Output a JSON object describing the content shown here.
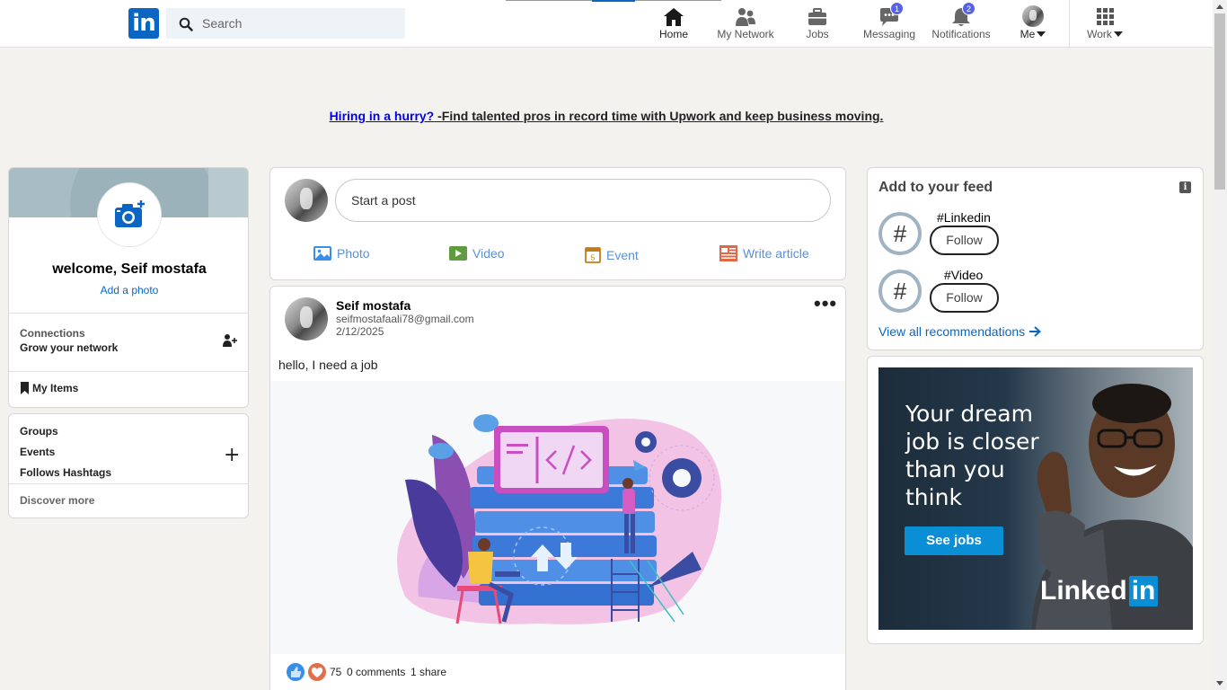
{
  "header": {
    "logo_text": "in",
    "search_placeholder": "Search",
    "nav": [
      {
        "label": "Home",
        "icon": "home-icon"
      },
      {
        "label": "My Network",
        "icon": "people-icon"
      },
      {
        "label": "Jobs",
        "icon": "briefcase-icon"
      },
      {
        "label": "Messaging",
        "icon": "chat-icon",
        "badge": "1"
      },
      {
        "label": "Notifications",
        "icon": "bell-icon",
        "badge": "2"
      },
      {
        "label": "Me",
        "icon": "avatar"
      },
      {
        "label": "Work",
        "icon": "grid-icon"
      }
    ]
  },
  "banner": {
    "link_text": "Hiring in a hurry?",
    "rest_text": " -Find talented pros in record time with Upwork and keep business moving."
  },
  "profile": {
    "welcome": "welcome, Seif mostafa",
    "add_photo": "Add a photo",
    "connections_label": "Connections",
    "connections_sub": "Grow your network",
    "my_items": "My Items"
  },
  "communities": {
    "groups": "Groups",
    "events": "Events",
    "hashtags": "Follows Hashtags",
    "discover": "Discover more"
  },
  "share": {
    "placeholder": "Start a post",
    "actions": [
      "Photo",
      "Video",
      "Event",
      "Write article"
    ],
    "event_day": "5"
  },
  "post": {
    "author": "Seif mostafa",
    "email": "seifmostafaali78@gmail.com",
    "date": "2/12/2025",
    "text": "hello, I need a job",
    "reactions": "75",
    "comments": "0 comments",
    "shares": "1 share"
  },
  "feed": {
    "title": "Add to your feed",
    "items": [
      {
        "name": "#Linkedin",
        "button": "Follow"
      },
      {
        "name": "#Video",
        "button": "Follow"
      }
    ],
    "view_all": "View all recommendations"
  },
  "ad": {
    "lines": [
      "Your dream",
      "job is closer",
      "than you",
      "think"
    ],
    "button": "See jobs",
    "logo_word": "Linked",
    "logo_in": "in"
  },
  "colors": {
    "brand": "#0a66c2",
    "badge": "#5562e8",
    "page_bg": "#f3f2ef"
  }
}
